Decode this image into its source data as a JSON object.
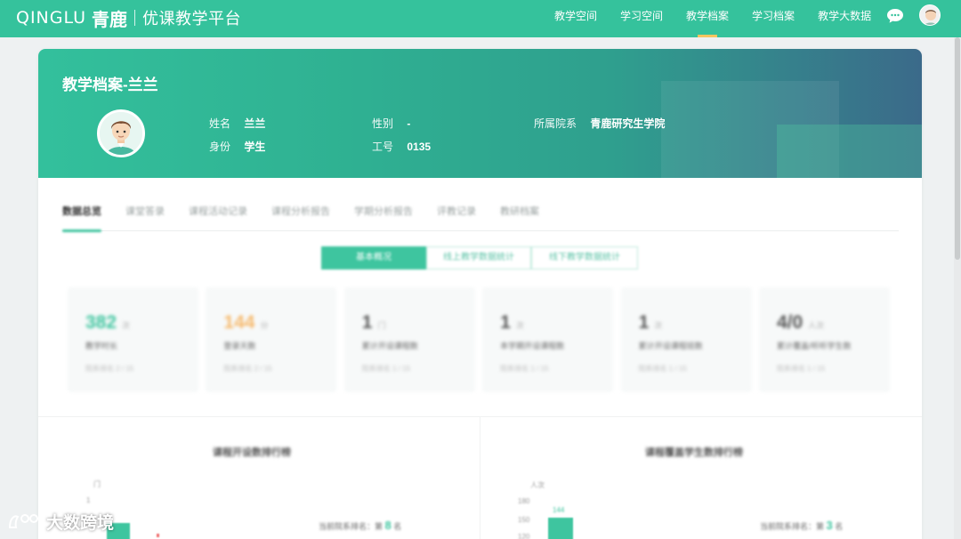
{
  "header": {
    "logo_en": "QINGLU",
    "logo_cn": "青鹿",
    "platform": "优课教学平台",
    "nav": [
      {
        "label": "教学空间",
        "active": false
      },
      {
        "label": "学习空间",
        "active": false
      },
      {
        "label": "教学档案",
        "active": true
      },
      {
        "label": "学习档案",
        "active": false
      },
      {
        "label": "教学大数据",
        "active": false
      }
    ],
    "icons": [
      "chat-icon",
      "user-avatar-icon"
    ]
  },
  "profile": {
    "title": "教学档案-兰兰",
    "name_label": "姓名",
    "name_value": "兰兰",
    "gender_label": "性别",
    "gender_value": "-",
    "college_label": "所属院系",
    "college_value": "青鹿研究生学院",
    "role_label": "身份",
    "role_value": "学生",
    "id_label": "工号",
    "id_value": "0135"
  },
  "tabs": [
    "数据总览",
    "课堂答录",
    "课程活动记录",
    "课程分析报告",
    "学期分析报告",
    "评教记录",
    "教研档案"
  ],
  "segments": [
    "基本概况",
    "线上教学数据统计",
    "线下教学数据统计"
  ],
  "stats": [
    {
      "value": "382",
      "unit": "次",
      "desc": "教学时长",
      "rank": "院系排名 2 / 15",
      "color": "#3ec59f"
    },
    {
      "value": "144",
      "unit": "分",
      "desc": "登录天数",
      "rank": "院系排名 2 / 15",
      "color": "#f6b86a"
    },
    {
      "value": "1",
      "unit": "门",
      "desc": "累计开设课程数",
      "rank": "院系排名 1 / 15",
      "color": "#555555"
    },
    {
      "value": "1",
      "unit": "次",
      "desc": "本学期开设课程数",
      "rank": "院系排名 1 / 15",
      "color": "#555555"
    },
    {
      "value": "1",
      "unit": "次",
      "desc": "累计开设课程班数",
      "rank": "院系排名 1 / 15",
      "color": "#555555"
    },
    {
      "value": "4/0",
      "unit": "人次",
      "desc": "累计覆盖/听听学生数",
      "rank": "院系排名 1 / 15",
      "color": "#555555"
    }
  ],
  "charts": {
    "left_title": "课程开设数排行榜",
    "right_title": "课程覆盖学生数排行榜",
    "left_unit": "门",
    "right_unit": "人次",
    "left_rank_label": "当前院系排名：第",
    "left_rank_value": "8",
    "left_rank_suffix": "名",
    "right_rank_label": "当前院系排名：第",
    "right_rank_value": "3",
    "right_rank_suffix": "名",
    "right_bar_label": "144",
    "left_ticks": [
      "1"
    ],
    "right_ticks": [
      "180",
      "150",
      "120"
    ]
  },
  "watermark": "大数跨境",
  "colors": {
    "primary": "#35c29c",
    "accent": "#f6c560",
    "orange": "#f6b86a"
  }
}
